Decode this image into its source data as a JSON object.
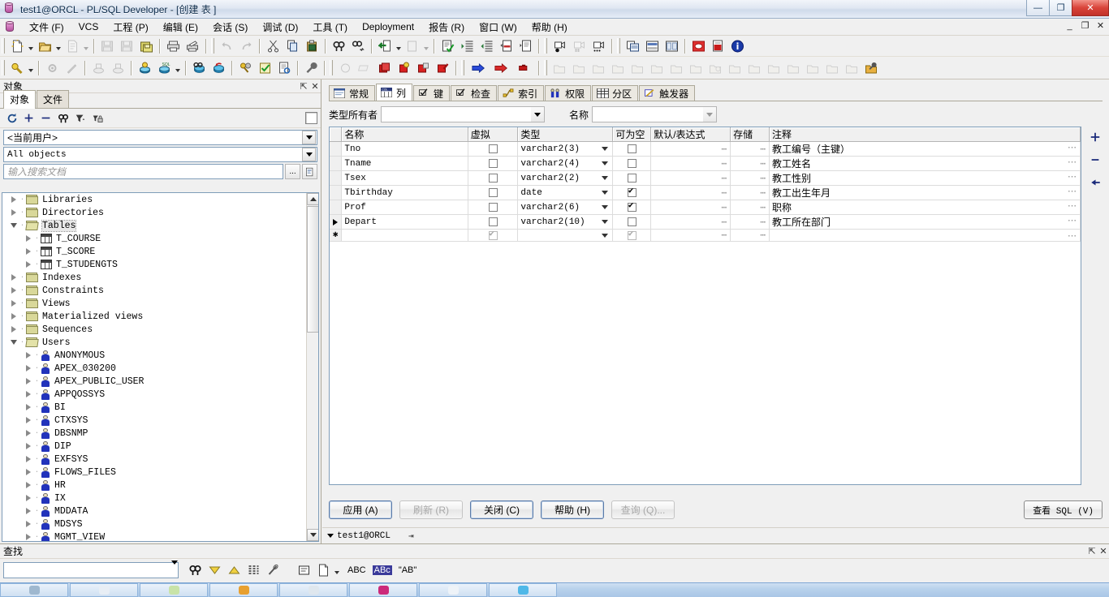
{
  "window": {
    "title": "test1@ORCL - PL/SQL Developer - [创建 表 ]",
    "minimize": "—",
    "maximize": "❐",
    "close": "✕",
    "mdi_minimize": "_",
    "mdi_restore": "❐",
    "mdi_close": "✕"
  },
  "menubar": {
    "items": [
      {
        "label": "文件 (F)"
      },
      {
        "label": "VCS"
      },
      {
        "label": "工程 (P)"
      },
      {
        "label": "编辑 (E)"
      },
      {
        "label": "会话 (S)"
      },
      {
        "label": "调试 (D)"
      },
      {
        "label": "工具 (T)"
      },
      {
        "label": "Deployment"
      },
      {
        "label": "报告 (R)"
      },
      {
        "label": "窗口 (W)"
      },
      {
        "label": "帮助 (H)"
      }
    ]
  },
  "sidebar": {
    "panel_title": "对象",
    "pin_icon": "pin-icon",
    "close_icon": "close-icon",
    "tabs": [
      {
        "label": "对象",
        "active": true
      },
      {
        "label": "文件",
        "active": false
      }
    ],
    "toolbar_icons": [
      "refresh-icon",
      "add-icon",
      "remove-icon",
      "find-icon",
      "filter-icon",
      "lock-find-icon"
    ],
    "user_filter": "<当前用户>",
    "object_filter": "All objects",
    "search_placeholder": "输入搜索文档",
    "search_value": "",
    "browse_button": "...",
    "copy_button": "copy-icon",
    "tree": [
      {
        "label": "Libraries",
        "type": "folder",
        "indent": 0,
        "expanded": false
      },
      {
        "label": "Directories",
        "type": "folder",
        "indent": 0,
        "expanded": false
      },
      {
        "label": "Tables",
        "type": "folder-open",
        "indent": 0,
        "expanded": true,
        "selected": true
      },
      {
        "label": "T_COURSE",
        "type": "table",
        "indent": 1,
        "expanded": false
      },
      {
        "label": "T_SCORE",
        "type": "table",
        "indent": 1,
        "expanded": false
      },
      {
        "label": "T_STUDENGTS",
        "type": "table",
        "indent": 1,
        "expanded": false
      },
      {
        "label": "Indexes",
        "type": "folder",
        "indent": 0,
        "expanded": false
      },
      {
        "label": "Constraints",
        "type": "folder",
        "indent": 0,
        "expanded": false
      },
      {
        "label": "Views",
        "type": "folder",
        "indent": 0,
        "expanded": false
      },
      {
        "label": "Materialized views",
        "type": "folder",
        "indent": 0,
        "expanded": false
      },
      {
        "label": "Sequences",
        "type": "folder",
        "indent": 0,
        "expanded": false
      },
      {
        "label": "Users",
        "type": "folder-open",
        "indent": 0,
        "expanded": true
      },
      {
        "label": "ANONYMOUS",
        "type": "user",
        "indent": 1,
        "expanded": false
      },
      {
        "label": "APEX_030200",
        "type": "user",
        "indent": 1,
        "expanded": false
      },
      {
        "label": "APEX_PUBLIC_USER",
        "type": "user",
        "indent": 1,
        "expanded": false
      },
      {
        "label": "APPQOSSYS",
        "type": "user",
        "indent": 1,
        "expanded": false
      },
      {
        "label": "BI",
        "type": "user",
        "indent": 1,
        "expanded": false
      },
      {
        "label": "CTXSYS",
        "type": "user",
        "indent": 1,
        "expanded": false
      },
      {
        "label": "DBSNMP",
        "type": "user",
        "indent": 1,
        "expanded": false
      },
      {
        "label": "DIP",
        "type": "user",
        "indent": 1,
        "expanded": false
      },
      {
        "label": "EXFSYS",
        "type": "user",
        "indent": 1,
        "expanded": false
      },
      {
        "label": "FLOWS_FILES",
        "type": "user",
        "indent": 1,
        "expanded": false
      },
      {
        "label": "HR",
        "type": "user",
        "indent": 1,
        "expanded": false
      },
      {
        "label": "IX",
        "type": "user",
        "indent": 1,
        "expanded": false
      },
      {
        "label": "MDDATA",
        "type": "user",
        "indent": 1,
        "expanded": false
      },
      {
        "label": "MDSYS",
        "type": "user",
        "indent": 1,
        "expanded": false
      },
      {
        "label": "MGMT_VIEW",
        "type": "user",
        "indent": 1,
        "expanded": false
      }
    ]
  },
  "editor": {
    "tabs": [
      {
        "label": "常规",
        "icon": "general-icon",
        "active": false
      },
      {
        "label": "列",
        "icon": "column-icon",
        "active": true
      },
      {
        "label": "键",
        "icon": "key-icon",
        "active": false
      },
      {
        "label": "检查",
        "icon": "check-icon",
        "active": false
      },
      {
        "label": "索引",
        "icon": "index-icon",
        "active": false
      },
      {
        "label": "权限",
        "icon": "privilege-icon",
        "active": false
      },
      {
        "label": "分区",
        "icon": "partition-icon",
        "active": false
      },
      {
        "label": "触发器",
        "icon": "trigger-icon",
        "active": false
      }
    ],
    "filters": {
      "type_owner_label": "类型所有者",
      "type_owner_value": "",
      "name_label": "名称",
      "name_value": ""
    },
    "grid": {
      "columns": [
        "名称",
        "虚拟",
        "类型",
        "可为空",
        "默认/表达式",
        "存储",
        "注释"
      ],
      "rows": [
        {
          "name": "Tno",
          "virtual": false,
          "type": "varchar2(3)",
          "nullable": false,
          "default": "",
          "storage": "",
          "comment": "教工编号（主键）",
          "current": false,
          "isnew": false
        },
        {
          "name": "Tname",
          "virtual": false,
          "type": "varchar2(4)",
          "nullable": false,
          "default": "",
          "storage": "",
          "comment": "教工姓名",
          "current": false,
          "isnew": false
        },
        {
          "name": "Tsex",
          "virtual": false,
          "type": "varchar2(2)",
          "nullable": false,
          "default": "",
          "storage": "",
          "comment": "教工性别",
          "current": false,
          "isnew": false
        },
        {
          "name": "Tbirthday",
          "virtual": false,
          "type": "date",
          "nullable": true,
          "default": "",
          "storage": "",
          "comment": "教工出生年月",
          "current": false,
          "isnew": false
        },
        {
          "name": "Prof",
          "virtual": false,
          "type": "varchar2(6)",
          "nullable": true,
          "default": "",
          "storage": "",
          "comment": "职称",
          "current": false,
          "isnew": false
        },
        {
          "name": "Depart",
          "virtual": false,
          "type": "varchar2(10)",
          "nullable": false,
          "default": "",
          "storage": "",
          "comment": "教工所在部门",
          "current": true,
          "isnew": false
        },
        {
          "name": "",
          "virtual": true,
          "type": "",
          "nullable": true,
          "default": "",
          "storage": "",
          "comment": "",
          "current": false,
          "isnew": true
        }
      ],
      "ellipsis": "⋯",
      "new_row_marker": "✱"
    },
    "side_buttons": [
      {
        "name": "add-column-button",
        "glyph": "✚"
      },
      {
        "name": "remove-column-button",
        "glyph": "▬"
      },
      {
        "name": "move-column-button",
        "glyph": "◀"
      }
    ],
    "buttons": [
      {
        "label": "应用 (A)",
        "enabled": true,
        "default": true
      },
      {
        "label": "刷新 (R)",
        "enabled": false,
        "default": false
      },
      {
        "label": "关闭 (C)",
        "enabled": true,
        "default": true
      },
      {
        "label": "帮助 (H)",
        "enabled": true,
        "default": true
      },
      {
        "label": "查询 (Q)...",
        "enabled": false,
        "default": false
      }
    ],
    "view_sql_button": "查看 SQL (V)"
  },
  "connection_bar": {
    "session": "test1@ORCL",
    "dropdown_icon": "chevron-down-icon",
    "pin_icon": "pin-icon"
  },
  "find_panel": {
    "title": "查找",
    "pin_icon": "pin-icon",
    "close_icon": "close-icon",
    "input_value": "",
    "tools": [
      {
        "name": "find-next-icon",
        "glyph": "🔍"
      },
      {
        "name": "find-down-icon",
        "glyph": "▽"
      },
      {
        "name": "find-up-icon",
        "glyph": "△"
      },
      {
        "name": "find-list-icon",
        "glyph": "≣"
      },
      {
        "name": "clear-icon",
        "glyph": "⌫"
      },
      {
        "name": "panel-icon",
        "glyph": "▤"
      },
      {
        "name": "copy-results-icon",
        "glyph": "🗎"
      },
      {
        "name": "dropdown-icon",
        "glyph": "▼"
      },
      {
        "name": "match-case-icon",
        "glyph": "ABC"
      },
      {
        "name": "match-word-icon",
        "glyph": "ABc"
      },
      {
        "name": "whole-word-icon",
        "glyph": "\"AB\""
      }
    ]
  },
  "toolbar1": {
    "groups": [
      {
        "items": [
          {
            "name": "new-icon",
            "enabled": true,
            "dropdown": true
          },
          {
            "name": "open-icon",
            "enabled": true,
            "dropdown": true
          },
          {
            "name": "recent-icon",
            "enabled": false,
            "dropdown": true
          }
        ]
      },
      {
        "items": [
          {
            "name": "save-icon",
            "enabled": false,
            "dropdown": false
          },
          {
            "name": "save-as-icon",
            "enabled": false,
            "dropdown": false
          },
          {
            "name": "save-all-icon",
            "enabled": true,
            "dropdown": false
          }
        ]
      },
      {
        "items": [
          {
            "name": "print-icon",
            "enabled": true,
            "dropdown": false
          },
          {
            "name": "print-setup-icon",
            "enabled": true,
            "dropdown": false
          }
        ]
      },
      {
        "items": [
          {
            "name": "undo-icon",
            "enabled": false,
            "dropdown": false
          },
          {
            "name": "redo-icon",
            "enabled": false,
            "dropdown": false
          }
        ]
      },
      {
        "items": [
          {
            "name": "cut-icon",
            "enabled": true,
            "dropdown": false
          },
          {
            "name": "copy-icon",
            "enabled": true,
            "dropdown": false
          },
          {
            "name": "paste-icon",
            "enabled": true,
            "dropdown": false
          }
        ]
      },
      {
        "items": [
          {
            "name": "find-icon",
            "enabled": true,
            "dropdown": false
          },
          {
            "name": "find-next-icon",
            "enabled": true,
            "dropdown": false
          }
        ]
      },
      {
        "items": [
          {
            "name": "go-to-icon",
            "enabled": true,
            "dropdown": true
          },
          {
            "name": "export-icon",
            "enabled": false,
            "dropdown": true
          }
        ]
      },
      {
        "items": [
          {
            "name": "syntax-check-icon",
            "enabled": true,
            "dropdown": false
          },
          {
            "name": "indent-icon",
            "enabled": true,
            "dropdown": false
          },
          {
            "name": "outdent-icon",
            "enabled": true,
            "dropdown": false
          },
          {
            "name": "comment-icon",
            "enabled": true,
            "dropdown": false
          },
          {
            "name": "uncomment-icon",
            "enabled": true,
            "dropdown": false
          }
        ]
      },
      {
        "items": [
          {
            "name": "record-macro-icon",
            "enabled": true,
            "dropdown": false
          },
          {
            "name": "pause-macro-icon",
            "enabled": false,
            "dropdown": false
          },
          {
            "name": "play-macro-icon",
            "enabled": true,
            "dropdown": false
          }
        ]
      },
      {
        "items": [
          {
            "name": "window-list-icon",
            "enabled": true,
            "dropdown": false
          },
          {
            "name": "tile-horizontal-icon",
            "enabled": true,
            "dropdown": false
          },
          {
            "name": "tile-vertical-icon",
            "enabled": true,
            "dropdown": false
          }
        ]
      },
      {
        "items": [
          {
            "name": "stop-icon",
            "enabled": true,
            "dropdown": false
          },
          {
            "name": "pdf-icon",
            "enabled": true,
            "dropdown": false
          },
          {
            "name": "info-icon",
            "enabled": true,
            "dropdown": false
          }
        ]
      }
    ]
  },
  "toolbar2": {
    "groups": [
      {
        "items": [
          {
            "name": "explain-plan-icon",
            "enabled": true,
            "dropdown": true
          }
        ]
      },
      {
        "items": [
          {
            "name": "settings-icon",
            "enabled": false,
            "dropdown": false
          },
          {
            "name": "wand-icon",
            "enabled": false,
            "dropdown": false
          }
        ]
      },
      {
        "items": [
          {
            "name": "import-icon",
            "enabled": false,
            "dropdown": false
          },
          {
            "name": "export-data-icon",
            "enabled": false,
            "dropdown": false
          }
        ]
      },
      {
        "items": [
          {
            "name": "new-session-icon",
            "enabled": true,
            "dropdown": false
          },
          {
            "name": "sql-window-icon",
            "enabled": true,
            "dropdown": true
          }
        ]
      },
      {
        "items": [
          {
            "name": "test-window-icon",
            "enabled": true,
            "dropdown": false
          },
          {
            "name": "rollback-icon",
            "enabled": true,
            "dropdown": false
          }
        ]
      },
      {
        "items": [
          {
            "name": "keys-icon",
            "enabled": true,
            "dropdown": false
          },
          {
            "name": "tasks-icon",
            "enabled": true,
            "dropdown": false
          },
          {
            "name": "report-icon",
            "enabled": true,
            "dropdown": false
          }
        ]
      },
      {
        "items": [
          {
            "name": "tools-icon",
            "enabled": true,
            "dropdown": false
          }
        ]
      },
      {
        "items": [
          {
            "name": "debug-step-icon",
            "enabled": false,
            "dropdown": false
          },
          {
            "name": "debug-clear-icon",
            "enabled": false,
            "dropdown": false
          },
          {
            "name": "breakpoint-icon",
            "enabled": true,
            "dropdown": false
          },
          {
            "name": "breakpoint-cond-icon",
            "enabled": true,
            "dropdown": false
          },
          {
            "name": "breakpoint-disable-icon",
            "enabled": true,
            "dropdown": false
          },
          {
            "name": "breakpoint-remove-icon",
            "enabled": true,
            "dropdown": false
          }
        ]
      },
      {
        "items": [
          {
            "name": "run-icon",
            "enabled": true,
            "dropdown": false
          },
          {
            "name": "debug-run-icon",
            "enabled": true,
            "dropdown": false
          },
          {
            "name": "stop-debug-icon",
            "enabled": true,
            "dropdown": false
          }
        ]
      },
      {
        "items": [
          {
            "name": "create-table-icon",
            "enabled": false,
            "dropdown": false
          },
          {
            "name": "create-view-icon",
            "enabled": false,
            "dropdown": false
          },
          {
            "name": "create-index-icon",
            "enabled": false,
            "dropdown": false
          },
          {
            "name": "create-seq-icon",
            "enabled": false,
            "dropdown": false
          },
          {
            "name": "create-syn-icon",
            "enabled": false,
            "dropdown": false
          },
          {
            "name": "create-trig-icon",
            "enabled": false,
            "dropdown": false
          },
          {
            "name": "create-proc-icon",
            "enabled": false,
            "dropdown": false
          },
          {
            "name": "create-func-icon",
            "enabled": false,
            "dropdown": false
          },
          {
            "name": "create-pkg-icon",
            "enabled": false,
            "dropdown": false
          },
          {
            "name": "create-type-icon",
            "enabled": false,
            "dropdown": false
          },
          {
            "name": "create-job-icon",
            "enabled": false,
            "dropdown": false
          },
          {
            "name": "create-queue-icon",
            "enabled": false,
            "dropdown": false
          },
          {
            "name": "create-user-icon",
            "enabled": false,
            "dropdown": false
          },
          {
            "name": "create-role-icon",
            "enabled": false,
            "dropdown": false
          },
          {
            "name": "create-profile-icon",
            "enabled": false,
            "dropdown": false
          },
          {
            "name": "create-db-link-icon",
            "enabled": false,
            "dropdown": false
          },
          {
            "name": "create-obj-icon",
            "enabled": true,
            "dropdown": false
          }
        ]
      }
    ]
  },
  "taskbar": {
    "items": [
      {
        "name": "taskbar-item-1",
        "color": "#9fb8cf"
      },
      {
        "name": "taskbar-item-2",
        "color": "#e8eef5"
      },
      {
        "name": "taskbar-item-3",
        "color": "#c8e3a8"
      },
      {
        "name": "taskbar-item-4",
        "color": "#e8a030"
      },
      {
        "name": "taskbar-item-5",
        "color": "#dfe7ee"
      },
      {
        "name": "taskbar-item-6",
        "color": "#cc2a7a"
      },
      {
        "name": "taskbar-item-7",
        "color": "#eef3f8"
      },
      {
        "name": "taskbar-item-8",
        "color": "#4fb8e8"
      }
    ]
  }
}
